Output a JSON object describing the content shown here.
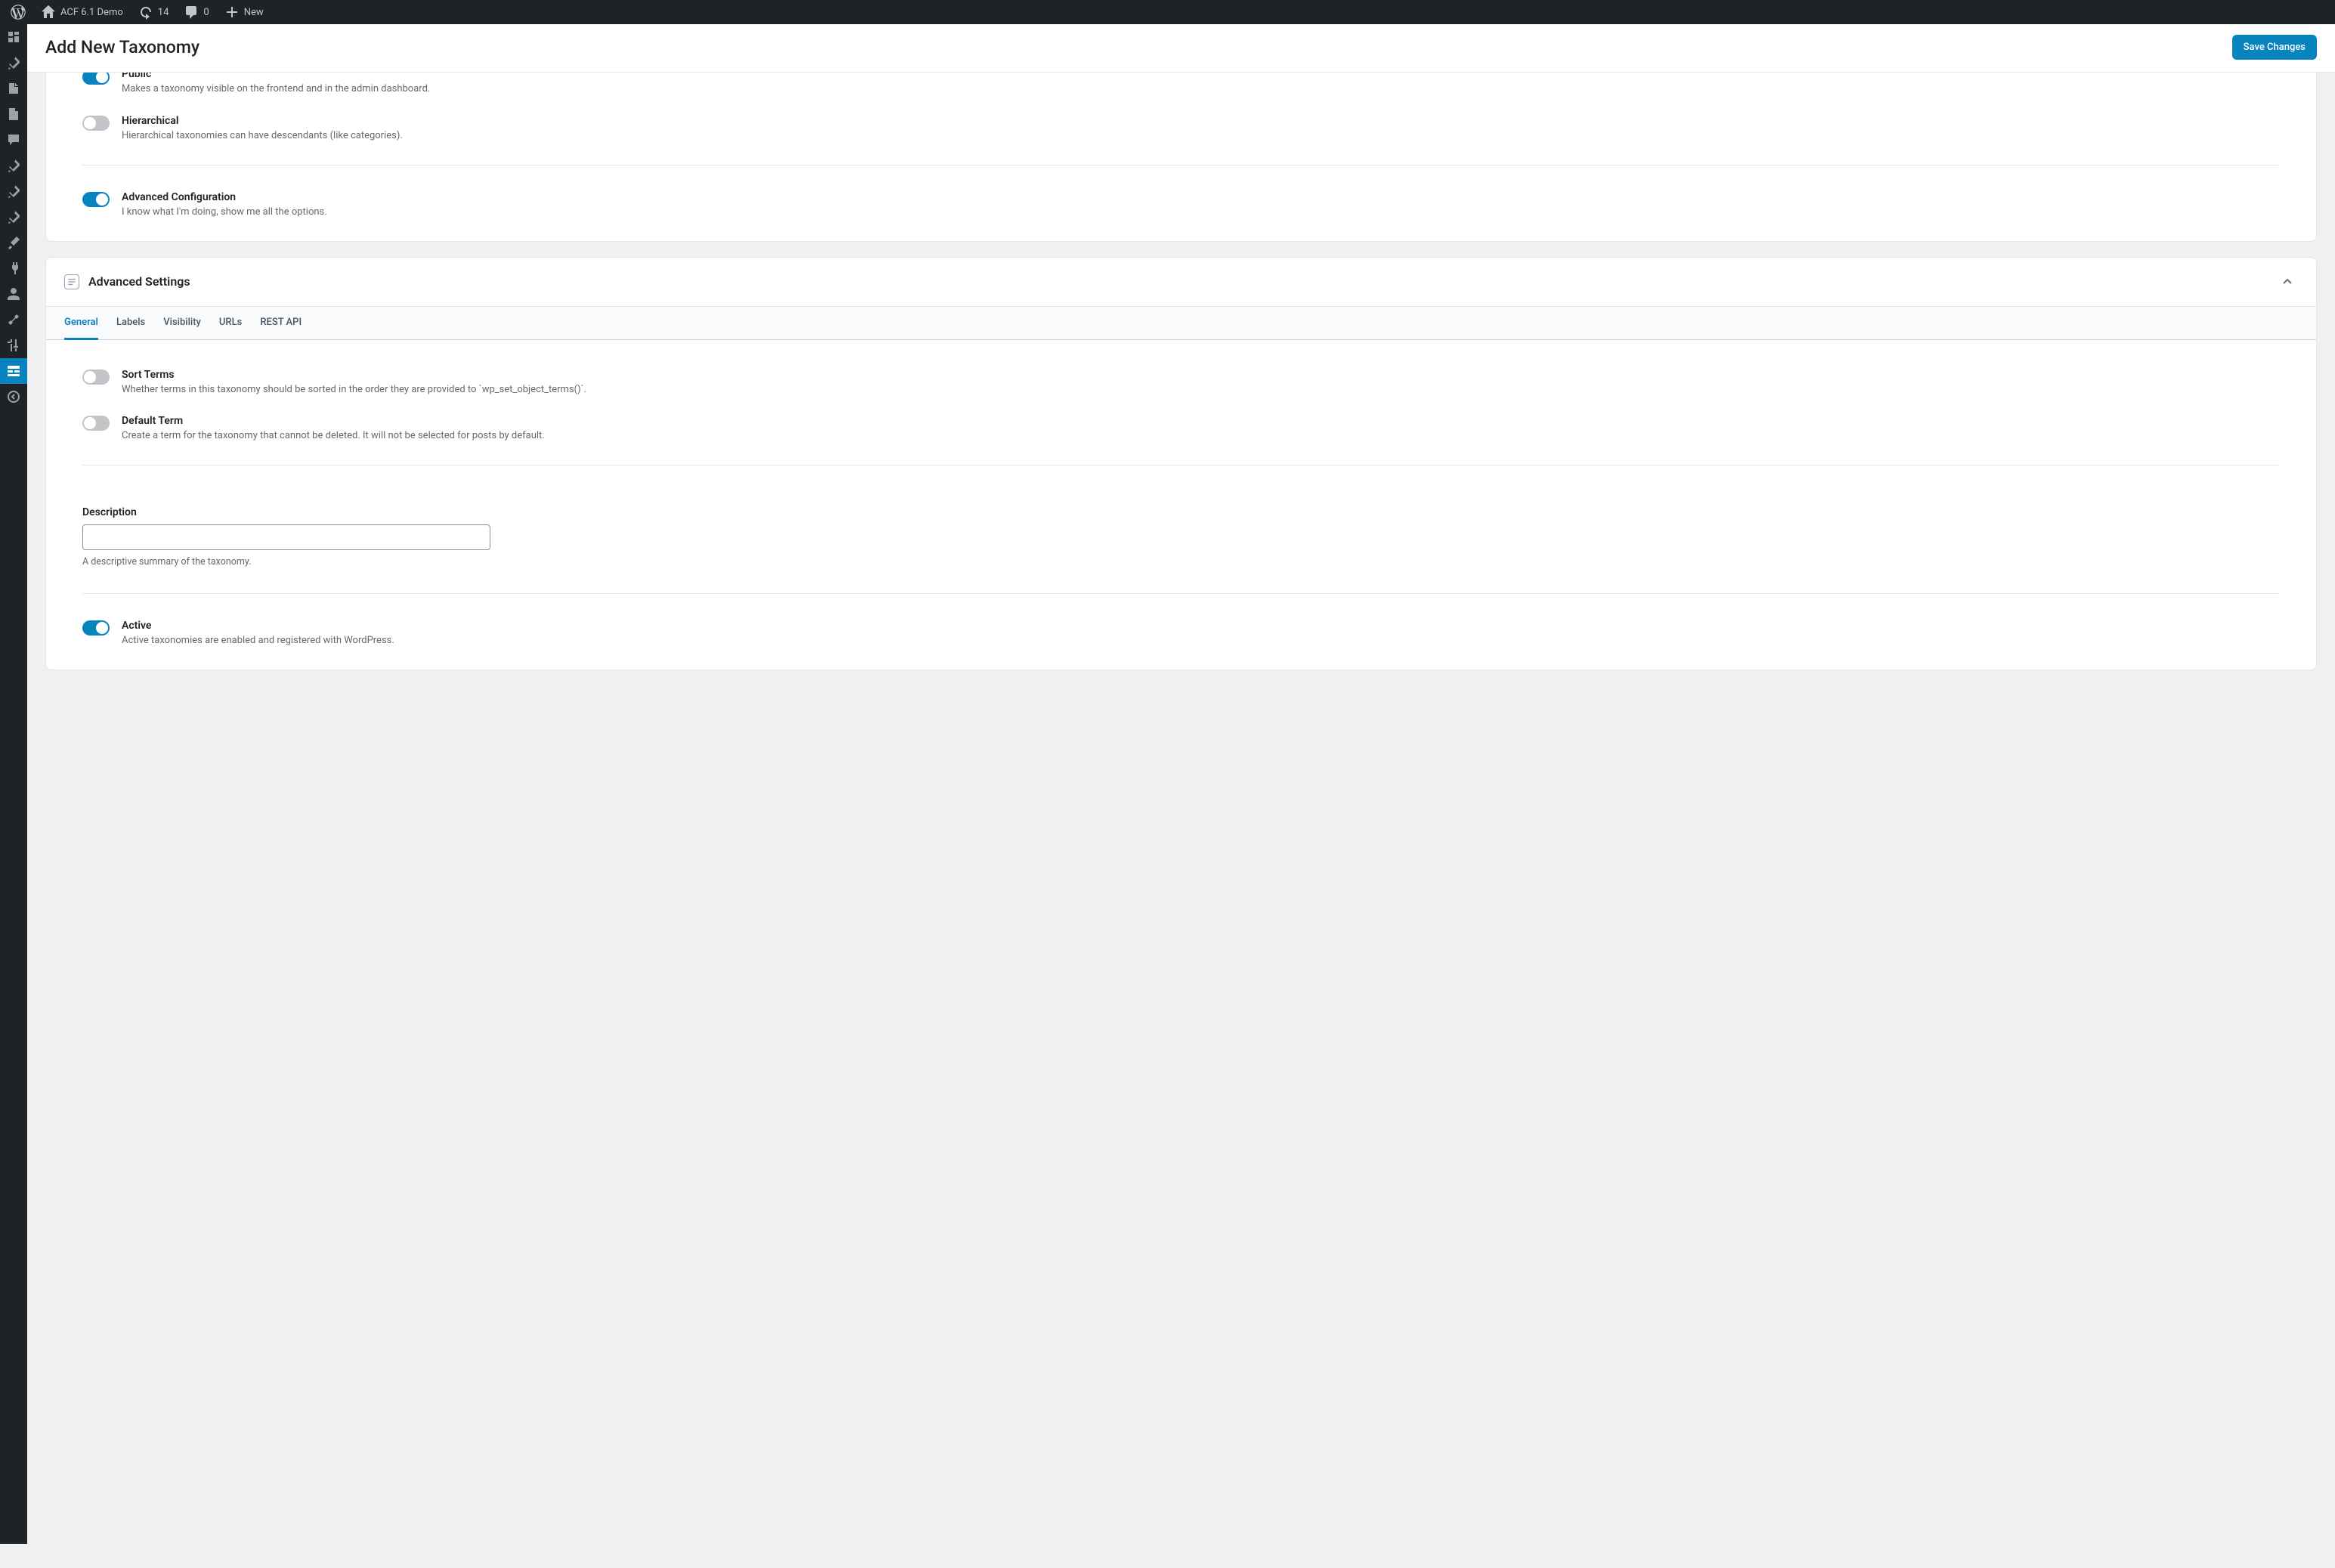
{
  "adminbar": {
    "site_name": "ACF 6.1 Demo",
    "updates_count": "14",
    "comments_count": "0",
    "new_label": "New"
  },
  "page": {
    "title": "Add New Taxonomy",
    "save_button": "Save Changes"
  },
  "basic": {
    "public": {
      "label": "Public",
      "help": "Makes a taxonomy visible on the frontend and in the admin dashboard."
    },
    "hierarchical": {
      "label": "Hierarchical",
      "help": "Hierarchical taxonomies can have descendants (like categories)."
    },
    "advanced_config": {
      "label": "Advanced Configuration",
      "help": "I know what I'm doing, show me all the options."
    }
  },
  "advanced_section": {
    "title": "Advanced Settings",
    "tabs": [
      "General",
      "Labels",
      "Visibility",
      "URLs",
      "REST API"
    ]
  },
  "general": {
    "sort_terms": {
      "label": "Sort Terms",
      "help": "Whether terms in this taxonomy should be sorted in the order they are provided to `wp_set_object_terms()`."
    },
    "default_term": {
      "label": "Default Term",
      "help": "Create a term for the taxonomy that cannot be deleted. It will not be selected for posts by default."
    },
    "description": {
      "label": "Description",
      "value": "",
      "help": "A descriptive summary of the taxonomy."
    },
    "active": {
      "label": "Active",
      "help": "Active taxonomies are enabled and registered with WordPress."
    }
  }
}
